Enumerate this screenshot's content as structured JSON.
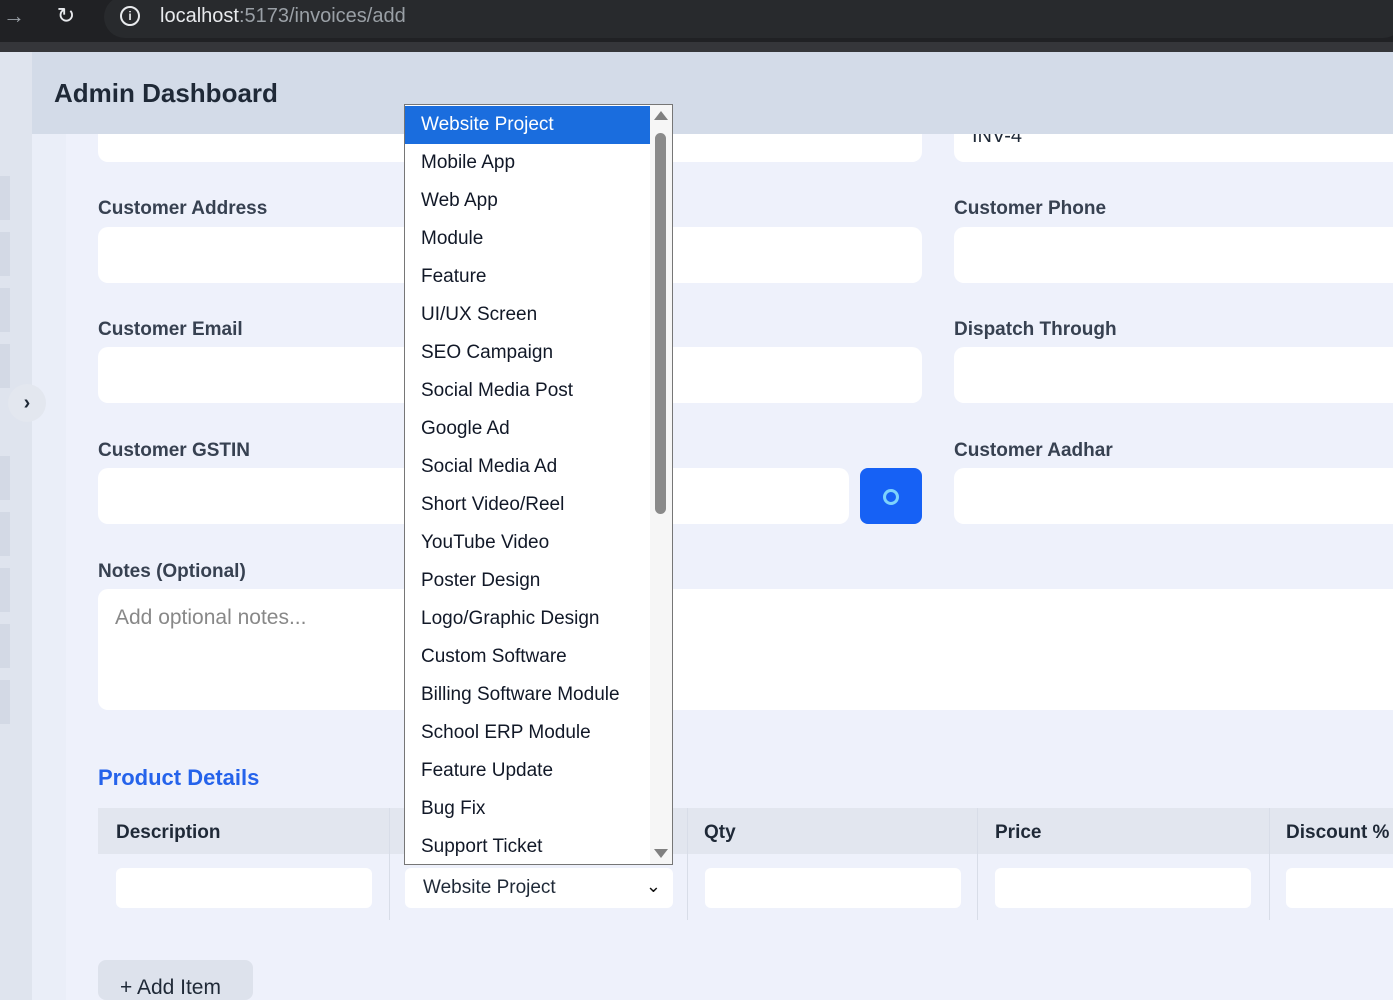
{
  "browser": {
    "url_host": "localhost",
    "url_rest": ":5173/invoices/add"
  },
  "header": {
    "title": "Admin Dashboard"
  },
  "form": {
    "invoice_number_value": "INV-4",
    "customer_address_label": "Customer Address",
    "customer_phone_label": "Customer Phone",
    "customer_email_label": "Customer Email",
    "dispatch_through_label": "Dispatch Through",
    "customer_gstin_label": "Customer GSTIN",
    "customer_aadhar_label": "Customer Aadhar",
    "notes_label": "Notes (Optional)",
    "notes_placeholder": "Add optional notes..."
  },
  "product_details": {
    "title": "Product Details",
    "columns": [
      "Description",
      "Qty",
      "Price",
      "Discount %"
    ],
    "row": {
      "category_value": "Website Project"
    },
    "add_item_label": "+ Add Item"
  },
  "dropdown": {
    "selected": "Website Project",
    "options": [
      "Website Project",
      "Mobile App",
      "Web App",
      "Module",
      "Feature",
      "UI/UX Screen",
      "SEO Campaign",
      "Social Media Post",
      "Google Ad",
      "Social Media Ad",
      "Short Video/Reel",
      "YouTube Video",
      "Poster Design",
      "Logo/Graphic Design",
      "Custom Software",
      "Billing Software Module",
      "School ERP Module",
      "Feature Update",
      "Bug Fix",
      "Support Ticket"
    ]
  },
  "colors": {
    "accent": "#2563eb",
    "selected_option": "#1a6dde",
    "search_button": "#1661f5"
  }
}
